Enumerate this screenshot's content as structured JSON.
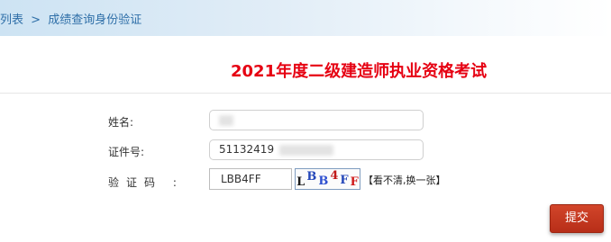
{
  "breadcrumb": {
    "items": [
      "列表",
      "成绩查询身份验证"
    ],
    "separator": ">"
  },
  "page_title": "2021年度二级建造师执业资格考试",
  "form": {
    "name": {
      "label": "姓名:",
      "value": ""
    },
    "id_number": {
      "label": "证件号:",
      "value": "51132419"
    },
    "captcha": {
      "label": "验证码 :",
      "value": "LBB4FF",
      "image_chars": [
        {
          "char": "L",
          "color": "#1a1a1a"
        },
        {
          "char": "B",
          "color": "#2346b8"
        },
        {
          "char": "B",
          "color": "#2d4fd0"
        },
        {
          "char": "4",
          "color": "#c01818"
        },
        {
          "char": "F",
          "color": "#2346b8"
        },
        {
          "char": "F",
          "color": "#d01b1b"
        }
      ],
      "refresh_link": "【看不清,换一张】"
    }
  },
  "submit_label": "提交",
  "colors": {
    "title": "#e60012",
    "breadcrumb": "#2f6fa8",
    "submit_button": "#c73a22"
  }
}
